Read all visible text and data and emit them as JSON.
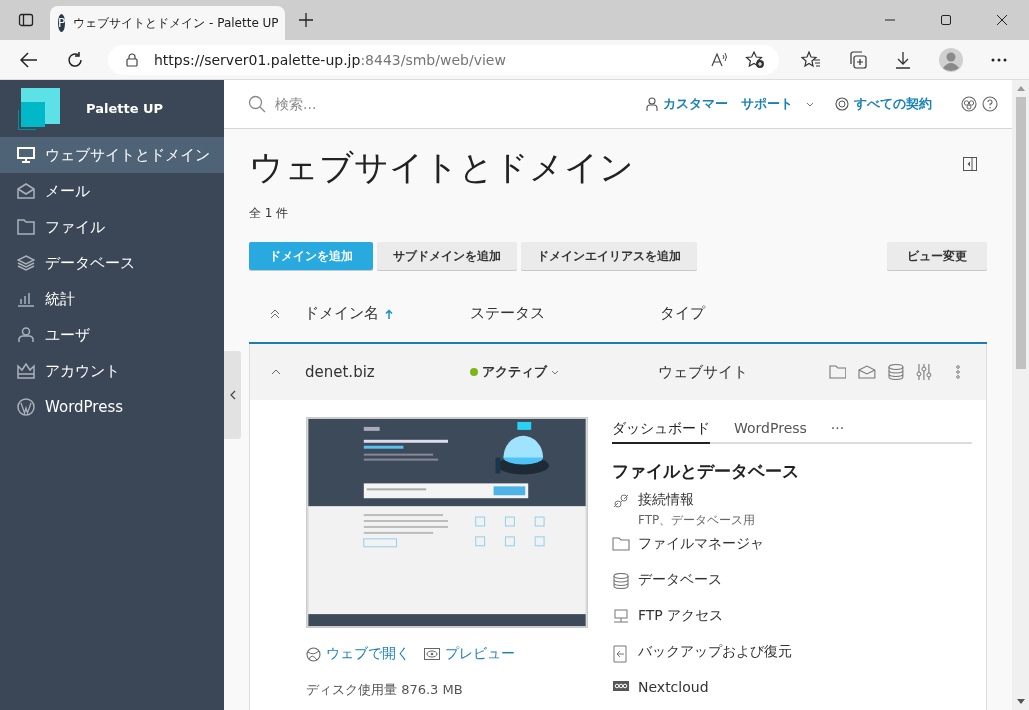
{
  "browser": {
    "tab_title": "ウェブサイトとドメイン - Palette UP",
    "tab_favicon": "P",
    "url_host": "https://server01.palette-up.jp",
    "url_path": ":8443/smb/web/view"
  },
  "sidebar": {
    "brand": "Palette UP",
    "items": [
      {
        "label": "ウェブサイトとドメイン",
        "selected": true
      },
      {
        "label": "メール",
        "selected": false
      },
      {
        "label": "ファイル",
        "selected": false
      },
      {
        "label": "データベース",
        "selected": false
      },
      {
        "label": "統計",
        "selected": false
      },
      {
        "label": "ユーザ",
        "selected": false
      },
      {
        "label": "アカウント",
        "selected": false
      },
      {
        "label": "WordPress",
        "selected": false
      }
    ]
  },
  "header": {
    "search": {
      "placeholder": "検索..."
    },
    "customer": "カスタマー",
    "support": "サポート",
    "subscriptions": "すべての契約"
  },
  "page": {
    "title": "ウェブサイトとドメイン",
    "count": "全 1 件",
    "buttons": [
      {
        "label": "ドメインを追加",
        "kind": "primary"
      },
      {
        "label": "サブドメインを追加",
        "kind": "secondary"
      },
      {
        "label": "ドメインエイリアスを追加",
        "kind": "secondary"
      }
    ],
    "view_button": "ビュー変更"
  },
  "table": {
    "columns": [
      {
        "label": "ドメイン名",
        "sorted": true
      },
      {
        "label": "ステータス",
        "sorted": false
      },
      {
        "label": "タイプ",
        "sorted": false
      }
    ],
    "rows": [
      {
        "domain": "denet.biz",
        "status": "アクティブ",
        "color": "#7cb518",
        "type": "ウェブサイト",
        "expanded": true
      }
    ]
  },
  "details": {
    "open_link": "ウェブで開く",
    "preview_link": "プレビュー",
    "disk_usage": "ディスク使用量 876.3 MB",
    "tabs": [
      {
        "label": "ダッシュボード",
        "selected": true
      },
      {
        "label": "WordPress",
        "selected": false
      },
      {
        "label": "···",
        "selected": false
      }
    ],
    "section_title": "ファイルとデータベース",
    "items": [
      {
        "label": "接続情報",
        "sub": "FTP、データベース用"
      },
      {
        "label": "ファイルマネージャ"
      },
      {
        "label": "データベース"
      },
      {
        "label": "FTP アクセス"
      },
      {
        "label": "バックアップおよび復元"
      },
      {
        "label": "Nextcloud"
      }
    ]
  }
}
